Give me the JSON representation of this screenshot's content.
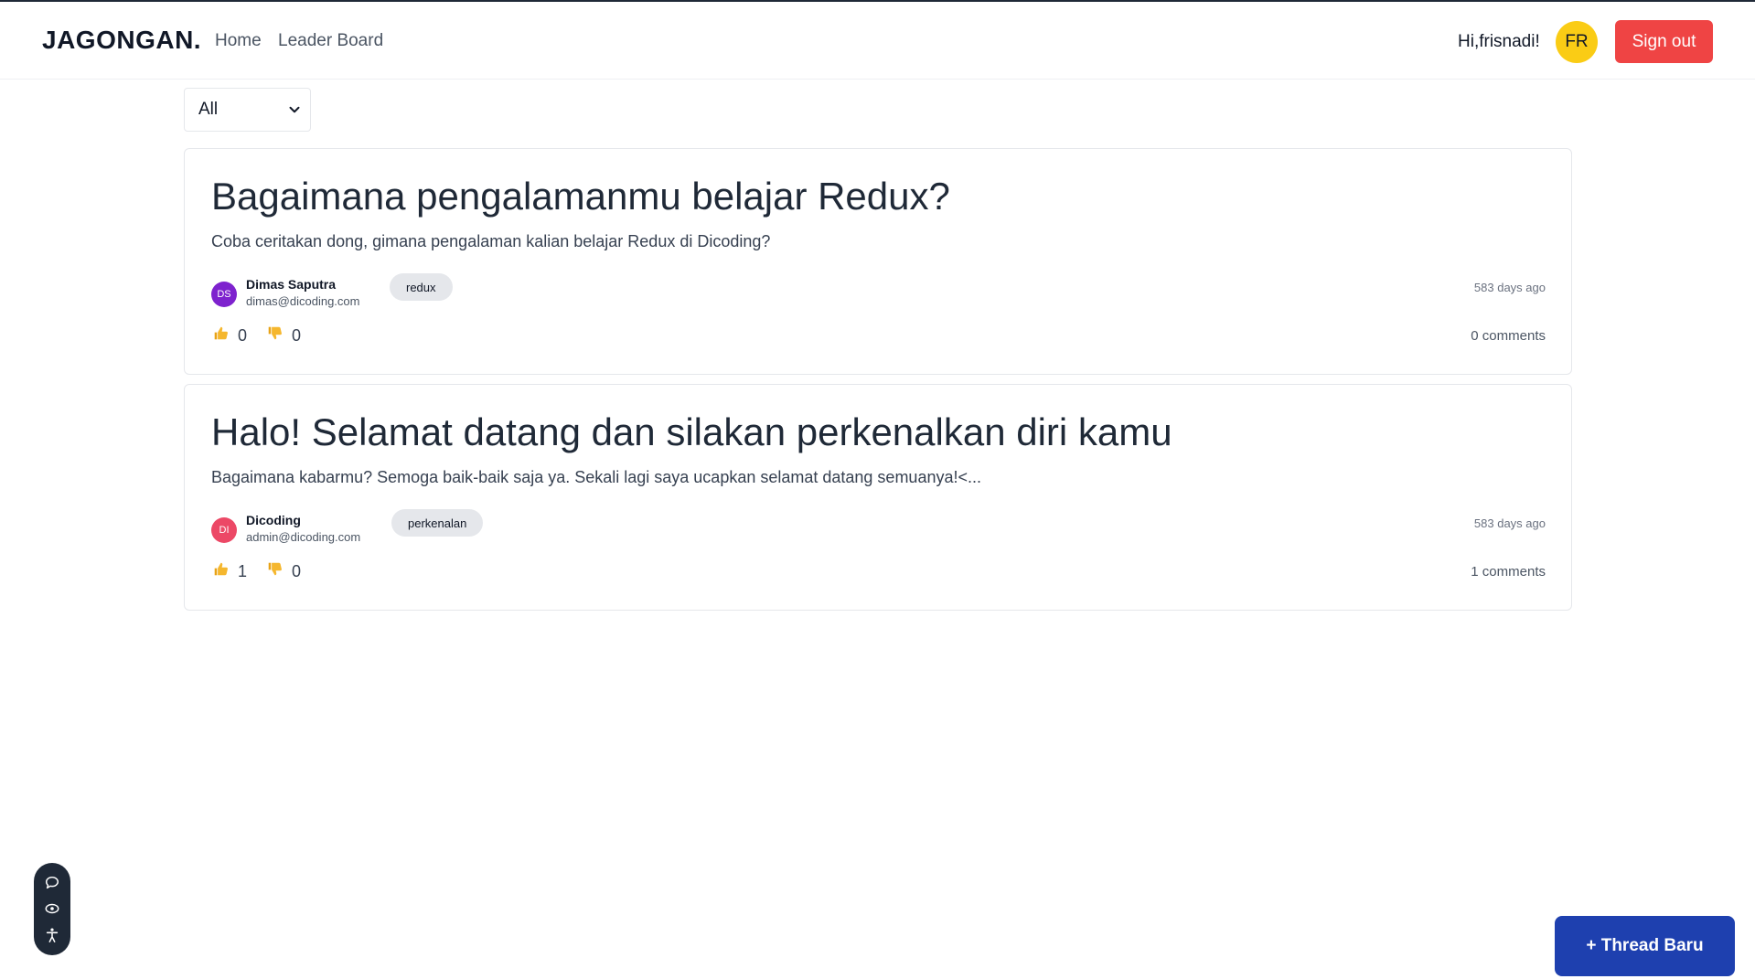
{
  "colors": {
    "accent_yellow": "#facc15",
    "signout_red": "#ef4444",
    "primary_blue": "#1e40af",
    "tag_bg": "#e5e7eb",
    "avatar_purple": "#7e22ce",
    "avatar_pink": "#ec4866"
  },
  "navbar": {
    "brand": "JAGONGAN.",
    "links": [
      "Home",
      "Leader Board"
    ],
    "greeting": "Hi,frisnadi!",
    "avatar_initials": "FR",
    "signout_label": "Sign out"
  },
  "filter": {
    "selected": "All",
    "icon": "chevron-down-icon"
  },
  "threads": [
    {
      "title": "Bagaimana pengalamanmu belajar Redux?",
      "body": "Coba ceritakan dong, gimana pengalaman kalian belajar Redux di Dicoding?",
      "owner": {
        "initials": "DS",
        "name": "Dimas Saputra",
        "email": "dimas@dicoding.com"
      },
      "tag": "redux",
      "created": "583 days ago",
      "upvotes": "0",
      "downvotes": "0",
      "comments": "0 comments"
    },
    {
      "title": "Halo! Selamat datang dan silakan perkenalkan diri kamu",
      "body": "Bagaimana kabarmu? Semoga baik-baik saja ya. Sekali lagi saya ucapkan selamat datang semuanya!<...",
      "owner": {
        "initials": "DI",
        "name": "Dicoding",
        "email": "admin@dicoding.com"
      },
      "tag": "perkenalan",
      "created": "583 days ago",
      "upvotes": "1",
      "downvotes": "0",
      "comments": "1 comments"
    }
  ],
  "side_toolbar": {
    "icons": [
      "chat-bubble-icon",
      "eye-icon",
      "accessibility-icon"
    ]
  },
  "new_thread_label": "+ Thread Baru"
}
